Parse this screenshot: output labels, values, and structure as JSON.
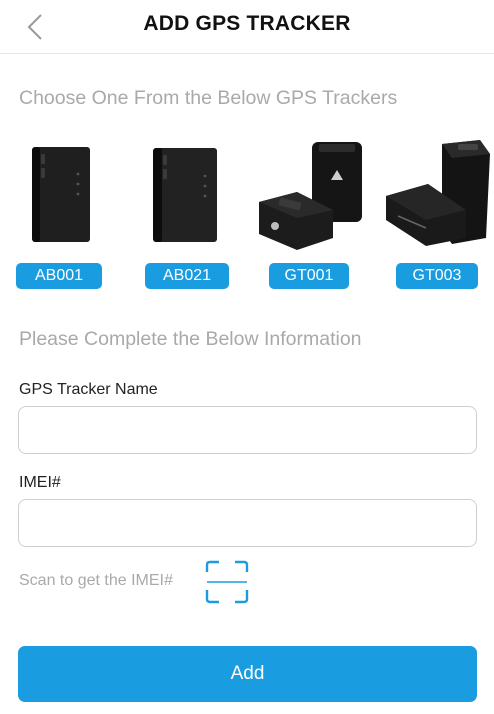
{
  "header": {
    "title": "ADD GPS TRACKER",
    "back_icon": "chevron-left-icon"
  },
  "section_choose": {
    "title": "Choose One From the Below GPS Trackers"
  },
  "trackers": [
    {
      "label": "AB001",
      "icon": "tracker-image"
    },
    {
      "label": "AB021",
      "icon": "tracker-image"
    },
    {
      "label": "GT001",
      "icon": "tracker-image"
    },
    {
      "label": "GT003",
      "icon": "tracker-image"
    }
  ],
  "section_info": {
    "title": "Please Complete the Below Information"
  },
  "form": {
    "name_label": "GPS Tracker Name",
    "name_value": "",
    "imei_label": "IMEI#",
    "imei_value": "",
    "scan_label": "Scan to get the IMEI#",
    "scan_icon": "scan-icon"
  },
  "actions": {
    "add_label": "Add"
  },
  "colors": {
    "accent": "#1a9de0",
    "muted_text": "#a9a9a9"
  }
}
